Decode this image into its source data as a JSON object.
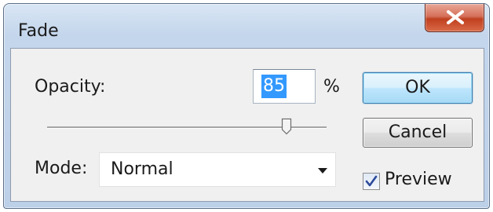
{
  "window": {
    "title": "Fade",
    "close_glyph": "X"
  },
  "opacity": {
    "label": "Opacity:",
    "value": "85",
    "unit": "%",
    "slider_value_percent": 85
  },
  "mode": {
    "label": "Mode:",
    "selected": "Normal"
  },
  "buttons": {
    "ok": "OK",
    "cancel": "Cancel"
  },
  "preview": {
    "label": "Preview",
    "checked": true
  },
  "icons": {
    "close": "close-icon",
    "dropdown": "dropdown-arrow-icon",
    "check": "checkmark-icon"
  },
  "colors": {
    "selection": "#3399ff",
    "close_button": "#c0401f",
    "default_button_border": "#3c7fb1"
  }
}
